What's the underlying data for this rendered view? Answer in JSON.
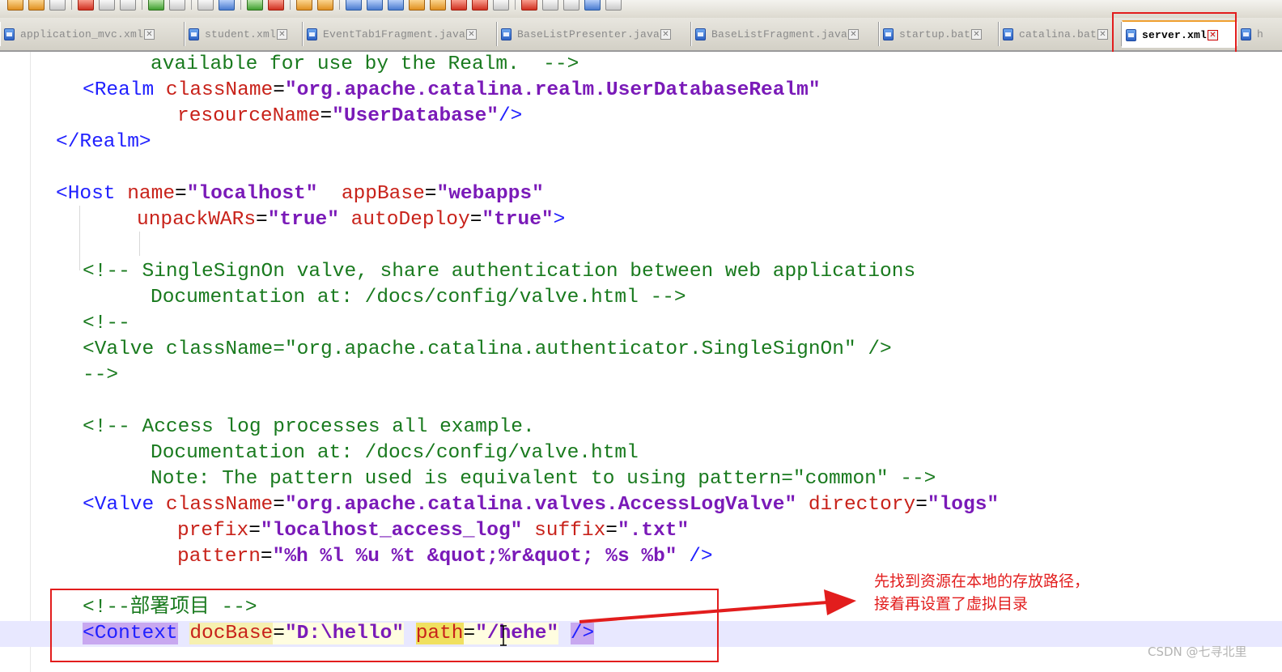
{
  "tabs": [
    {
      "label": "application_mvc.xml",
      "active": false
    },
    {
      "label": "student.xml",
      "active": false
    },
    {
      "label": "EventTab1Fragment.java",
      "active": false
    },
    {
      "label": "BaseListPresenter.java",
      "active": false
    },
    {
      "label": "BaseListFragment.java",
      "active": false
    },
    {
      "label": "startup.bat",
      "active": false
    },
    {
      "label": "catalina.bat",
      "active": false
    },
    {
      "label": "server.xml",
      "active": true
    },
    {
      "label": "h",
      "active": false
    }
  ],
  "code": {
    "l1": "available for use by the Realm.  -->",
    "l2_tag": "<Realm",
    "l2_attr": "className",
    "l2_val": "\"org.apache.catalina.realm.UserDatabaseRealm\"",
    "l3_attr": "resourceName",
    "l3_val": "\"UserDatabase\"",
    "l3_end": "/>",
    "l4": "</Realm>",
    "l6_tag": "<Host",
    "l6_a1": "name",
    "l6_v1": "\"localhost\"",
    "l6_a2": "appBase",
    "l6_v2": "\"webapps\"",
    "l7_a1": "unpackWARs",
    "l7_v1": "\"true\"",
    "l7_a2": "autoDeploy",
    "l7_v2": "\"true\"",
    "l7_end": ">",
    "l9": "<!-- SingleSignOn valve, share authentication between web applications",
    "l10": "Documentation at: /docs/config/valve.html -->",
    "l11": "<!--",
    "l12": "<Valve className=\"org.apache.catalina.authenticator.SingleSignOn\" />",
    "l13": "-->",
    "l15": "<!-- Access log processes all example.",
    "l16": "Documentation at: /docs/config/valve.html",
    "l17": "Note: The pattern used is equivalent to using pattern=\"common\" -->",
    "l18_tag": "<Valve",
    "l18_a1": "className",
    "l18_v1": "\"org.apache.catalina.valves.AccessLogValve\"",
    "l18_a2": "directory",
    "l18_v2": "\"logs\"",
    "l19_a1": "prefix",
    "l19_v1": "\"localhost_access_log\"",
    "l19_a2": "suffix",
    "l19_v2": "\".txt\"",
    "l20_a": "pattern",
    "l20_v": "\"%h %l %u %t &quot;%r&quot; %s %b\"",
    "l20_end": "/>",
    "l22": "<!--部署项目 -->",
    "l23_tag": "<Context",
    "l23_a1": "docBase",
    "l23_v1": "\"D:\\hello\"",
    "l23_a2": "path",
    "l23_v2": "\"/hehe\"",
    "l23_end": "/>"
  },
  "annotation": {
    "line1": "先找到资源在本地的存放路径，",
    "line2": "接着再设置了虚拟目录"
  },
  "watermark": "CSDN @七寻北里",
  "colors": {
    "annotation": "#e21d1d",
    "comment": "#197a1e",
    "tag": "#2020ff",
    "attribute": "#c8221a",
    "value": "#7a1ab8"
  }
}
